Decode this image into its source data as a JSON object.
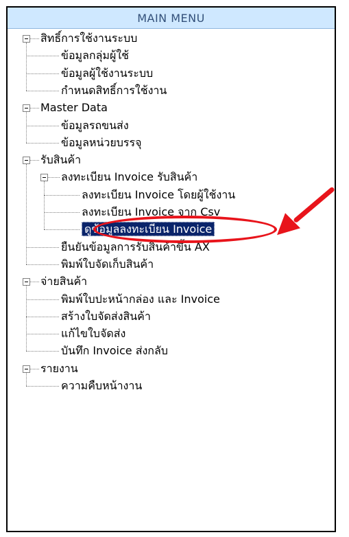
{
  "menu": {
    "title": "MAIN MENU",
    "items": [
      {
        "label": "สิทธิ์การใช้งานระบบ",
        "level": 0,
        "expandable": true
      },
      {
        "label": "ข้อมูลกลุ่มผู้ใช้",
        "level": 1
      },
      {
        "label": "ข้อมูลผู้ใช้งานระบบ",
        "level": 1
      },
      {
        "label": "กำหนดสิทธิ์การใช้งาน",
        "level": 1
      },
      {
        "label": "Master Data",
        "level": 0,
        "expandable": true
      },
      {
        "label": "ข้อมูลรถขนส่ง",
        "level": 1
      },
      {
        "label": "ข้อมูลหน่วยบรรจุ",
        "level": 1
      },
      {
        "label": "รับสินค้า",
        "level": 0,
        "expandable": true
      },
      {
        "label": "ลงทะเบียน Invoice รับสินค้า",
        "level": 1,
        "expandable": true
      },
      {
        "label": "ลงทะเบียน Invoice โดยผู้ใช้งาน",
        "level": 2
      },
      {
        "label": "ลงทะเบียน Invoice จาก Csv",
        "level": 2
      },
      {
        "label": "ดูข้อมูลลงทะเบียน Invoice",
        "level": 2,
        "selected": true
      },
      {
        "label": "ยืนยันข้อมูลการรับสินค้าขึ้น AX",
        "level": 1
      },
      {
        "label": "พิมพ์ใบจัดเก็บสินค้า",
        "level": 1
      },
      {
        "label": "จ่ายสินค้า",
        "level": 0,
        "expandable": true
      },
      {
        "label": "พิมพ์ใบปะหน้ากล่อง และ Invoice",
        "level": 1
      },
      {
        "label": "สร้างใบจัดส่งสินค้า",
        "level": 1
      },
      {
        "label": "แก้ไขใบจัดส่ง",
        "level": 1
      },
      {
        "label": "บันทึก Invoice ส่งกลับ",
        "level": 1
      },
      {
        "label": "รายงาน",
        "level": 0,
        "expandable": true
      },
      {
        "label": "ความคืบหน้างาน",
        "level": 1
      }
    ]
  },
  "annotation": {
    "highlight_color": "#e8141b",
    "arrow_color": "#e8141b",
    "target": "ดูข้อมูลลงทะเบียน Invoice"
  }
}
